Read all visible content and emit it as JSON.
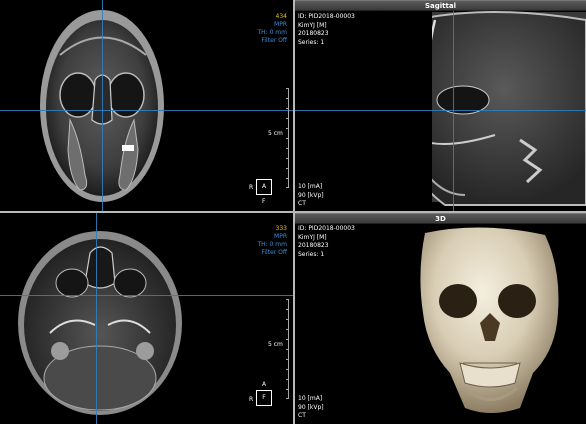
{
  "viewports": {
    "axial_top": {
      "slice_number": "434",
      "mode": "MPR",
      "thickness": "TH: 0 mm",
      "filter": "Filter Off",
      "scale_label": "5 cm",
      "orient_left": "R",
      "orient_box": "A",
      "orient_bottom": "F"
    },
    "sagittal": {
      "title": "Sagittal",
      "patient_id": "ID: PID2018-00003",
      "patient_name": "KimYJ [M]",
      "study_date": "20180823",
      "series": "Series: 1",
      "ma": "10 [mA]",
      "kvp": "90 [kVp]",
      "modality": "CT"
    },
    "axial_bottom": {
      "slice_number": "333",
      "mode": "MPR",
      "thickness": "TH: 0 mm",
      "filter": "Filter Off",
      "scale_label": "5 cm",
      "orient_top": "A",
      "orient_left": "R",
      "orient_box": "F"
    },
    "view_3d": {
      "title": "3D",
      "patient_id": "ID: PID2018-00003",
      "patient_name": "KimYJ [M]",
      "study_date": "20180823",
      "series": "Series: 1",
      "ma": "10 [mA]",
      "kvp": "90 [kVp]",
      "modality": "CT"
    }
  },
  "colors": {
    "crosshair": "#2e80c0",
    "slice_number": "#e8c020",
    "overlay_blue": "#3c8ed8",
    "divider": "#b8b8b8"
  }
}
